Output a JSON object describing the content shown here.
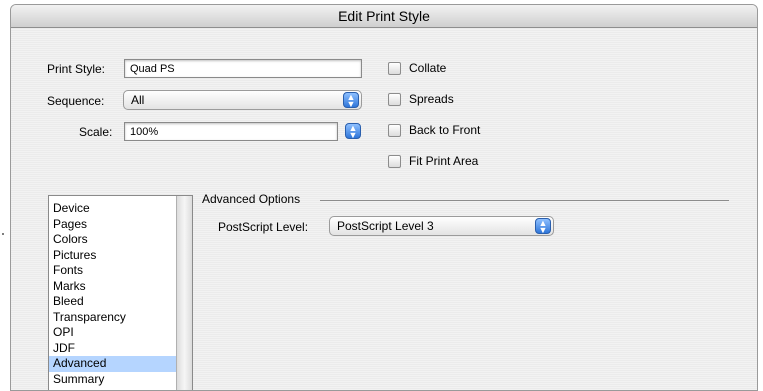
{
  "window": {
    "title": "Edit Print Style"
  },
  "fields": {
    "print_style_label": "Print Style:",
    "print_style_value": "Quad PS",
    "sequence_label": "Sequence:",
    "sequence_value": "All",
    "scale_label": "Scale:",
    "scale_value": "100%"
  },
  "checkboxes": [
    {
      "label": "Collate",
      "checked": false
    },
    {
      "label": "Spreads",
      "checked": false
    },
    {
      "label": "Back to Front",
      "checked": false
    },
    {
      "label": "Fit Print Area",
      "checked": false
    }
  ],
  "categories": {
    "items": [
      "Device",
      "Pages",
      "Colors",
      "Pictures",
      "Fonts",
      "Marks",
      "Bleed",
      "Transparency",
      "OPI",
      "JDF",
      "Advanced",
      "Summary"
    ],
    "selected": "Advanced"
  },
  "advanced": {
    "group_title": "Advanced Options",
    "postscript_label": "PostScript Level:",
    "postscript_value": "PostScript Level 3"
  },
  "colors": {
    "selection": "#b5d5ff",
    "stepper_accent": "#2f76d9"
  }
}
